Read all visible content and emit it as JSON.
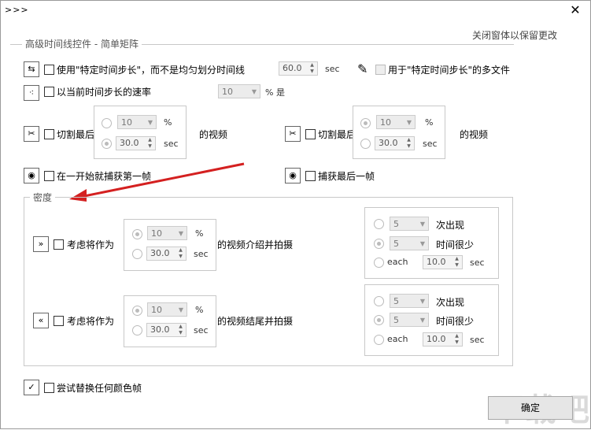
{
  "window": {
    "title": ">>>",
    "close_glyph": "✕"
  },
  "hint": "关闭窗体以保留更改",
  "advanced": {
    "legend": "高级时间线控件 - 简单矩阵",
    "row1": {
      "label": "使用\"特定时间步长\"，而不是均匀划分时间线",
      "value": "60.0",
      "unit": "sec",
      "right_label": "用于\"特定时间步长\"的多文件"
    },
    "row2": {
      "label": "以当前时间步长的速率",
      "value": "10",
      "unit": "% 是"
    },
    "cut_left": {
      "label": "切割最后",
      "pct_value": "10",
      "pct_unit": "%",
      "sec_value": "30.0",
      "sec_unit": "sec",
      "suffix": "的视频"
    },
    "cut_right": {
      "label": "切割最后",
      "pct_value": "10",
      "pct_unit": "%",
      "sec_value": "30.0",
      "sec_unit": "sec",
      "suffix": "的视频"
    },
    "capture_first": "在一开始就捕获第一帧",
    "capture_last": "捕获最后一帧"
  },
  "density": {
    "legend": "密度",
    "intro": {
      "label": "考虑将作为",
      "pct_value": "10",
      "pct_unit": "%",
      "sec_value": "30.0",
      "sec_unit": "sec",
      "suffix": "的视频介绍并拍摄",
      "times_value": "5",
      "times_label": "次出现",
      "few_value": "5",
      "few_label": "时间很少",
      "each_label": "each",
      "each_value": "10.0",
      "each_unit": "sec"
    },
    "outro": {
      "label": "考虑将作为",
      "pct_value": "10",
      "pct_unit": "%",
      "sec_value": "30.0",
      "sec_unit": "sec",
      "suffix": "的视频结尾并拍摄",
      "times_value": "5",
      "times_label": "次出现",
      "few_value": "5",
      "few_label": "时间很少",
      "each_label": "each",
      "each_value": "10.0",
      "each_unit": "sec"
    }
  },
  "replace_color": "尝试替换任何颜色帧",
  "ok_button": "确定",
  "watermark": "下载吧"
}
